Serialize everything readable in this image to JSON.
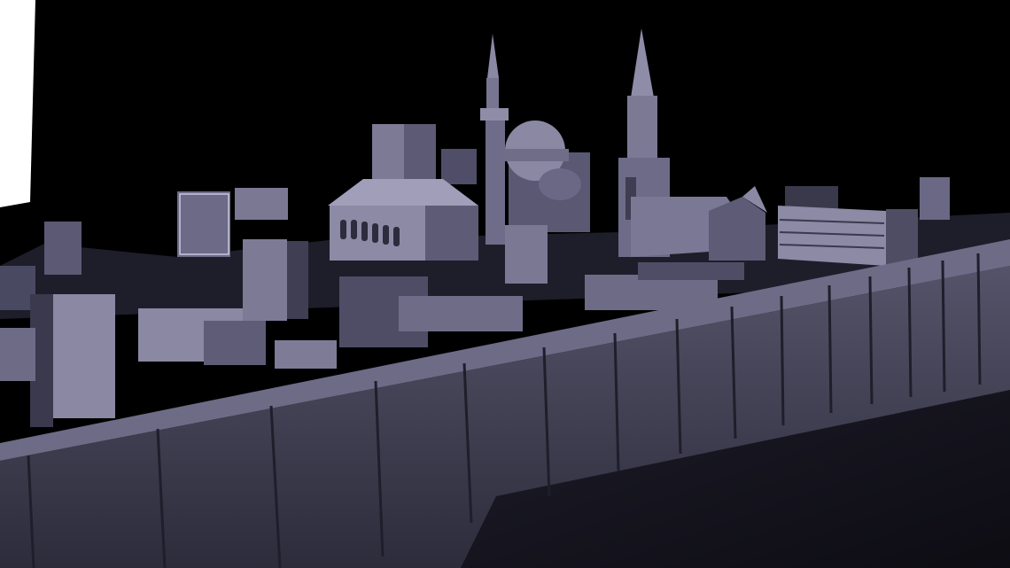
{
  "scene": {
    "subject": "night-city-render",
    "colors": {
      "sky": "#000000",
      "light_panel": "#ffffff",
      "building_lit": "#8a88a3",
      "building_mid": "#5d5b75",
      "building_shadow": "#2c2b3a",
      "wall_face": "#3f3d52",
      "ground": "#15141d"
    }
  }
}
